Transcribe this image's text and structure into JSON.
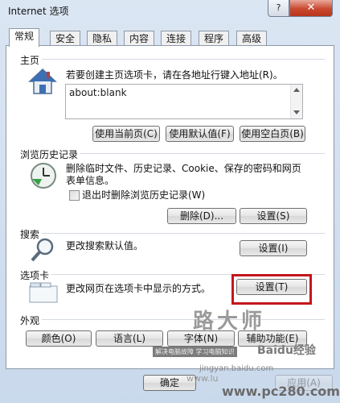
{
  "window": {
    "title": "Internet 选项",
    "help_label": "?",
    "close_label": "✕"
  },
  "tabs": [
    "常规",
    "安全",
    "隐私",
    "内容",
    "连接",
    "程序",
    "高级"
  ],
  "home": {
    "title": "主页",
    "description": "若要创建主页选项卡，请在各地址行键入地址(R)。",
    "url": "about:blank",
    "buttons": {
      "use_current": "使用当前页(C)",
      "use_default": "使用默认值(F)",
      "use_blank": "使用空白页(B)"
    }
  },
  "history": {
    "title": "浏览历史记录",
    "description_line1": "删除临时文件、历史记录、Cookie、保存的密码和网页",
    "description_line2": "表单信息。",
    "checkbox_label": "退出时删除浏览历史记录(W)",
    "delete_button": "删除(D)...",
    "settings_button": "设置(S)"
  },
  "search": {
    "title": "搜索",
    "description": "更改搜索默认值。",
    "settings_button": "设置(I)"
  },
  "tabs_group": {
    "title": "选项卡",
    "description": "更改网页在选项卡中显示的方式。",
    "settings_button": "设置(T)"
  },
  "appearance": {
    "title": "外观",
    "buttons": {
      "colors": "颜色(O)",
      "languages": "语言(L)",
      "fonts": "字体(N)",
      "accessibility": "辅助功能(E)"
    }
  },
  "footer": {
    "ok_label": "确定",
    "apply_label": "应用(A)"
  },
  "watermark": {
    "line1": "路大师",
    "line2": "解决电脑故障  学习电脑知识",
    "site1": "jingyan.baidu.com",
    "brand": "Baidu经验",
    "site2": "www.pc280.com",
    "prefix": "www.lu"
  },
  "colors": {
    "highlight": "#c4161c",
    "panel_border": "#8d99a8",
    "close_button": "#c9482e"
  }
}
